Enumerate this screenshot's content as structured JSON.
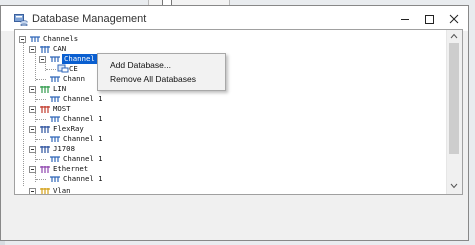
{
  "window": {
    "title": "Database Management"
  },
  "tree": {
    "root": "Channels",
    "buses": [
      {
        "name": "CAN",
        "channel": "Channel 1",
        "children_visible": [
          "CE"
        ]
      },
      {
        "name": "LIN",
        "channel": "Channel 1"
      },
      {
        "name": "MOST",
        "channel": "Channel 1"
      },
      {
        "name": "FlexRay",
        "channel": "Channel 1"
      },
      {
        "name": "J1708",
        "channel": "Channel 1"
      },
      {
        "name": "Ethernet",
        "channel": "Channel 1"
      },
      {
        "name": "Vlan"
      }
    ],
    "extra_truncated": "Chann"
  },
  "context_menu": {
    "items": [
      "Add Database...",
      "Remove All Databases"
    ]
  },
  "colors": {
    "selection": "#0a5fd0",
    "window_bg": "#f0f0f0"
  }
}
